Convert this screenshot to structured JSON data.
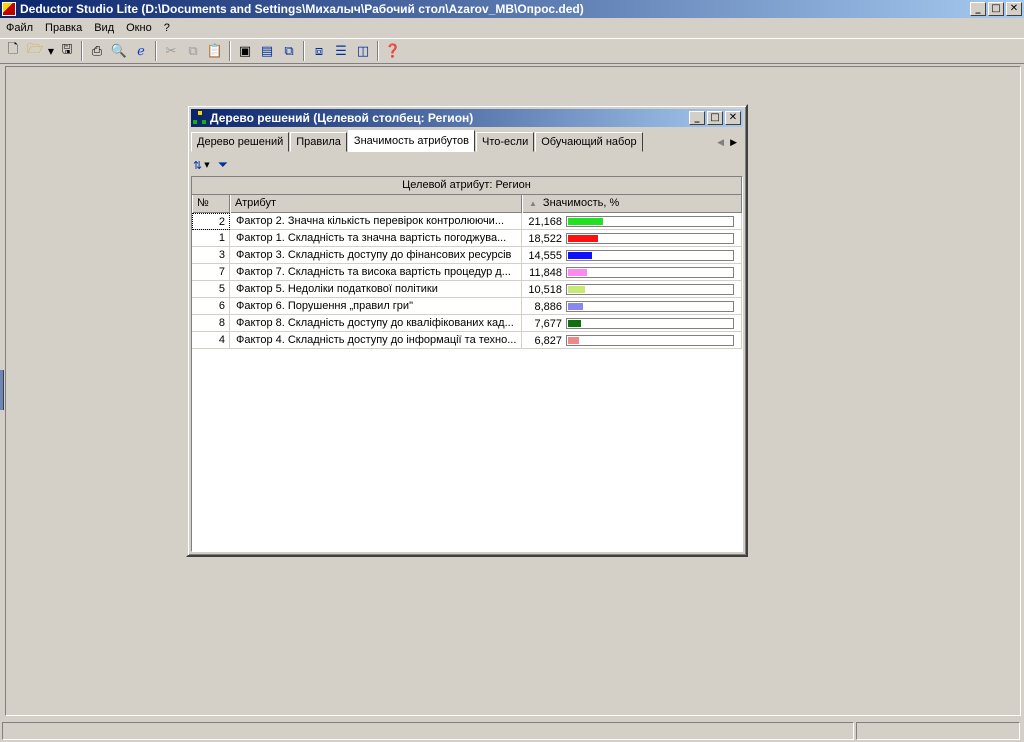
{
  "app": {
    "title": "Deductor Studio Lite (D:\\Documents and Settings\\Михалыч\\Рабочий стол\\Azarov_MB\\Опрос.ded)",
    "window_buttons": {
      "minimize": "_",
      "maximize": "□",
      "close": "✕"
    }
  },
  "menu": [
    "Файл",
    "Правка",
    "Вид",
    "Окно",
    "?"
  ],
  "toolbar_icons": [
    "new-icon",
    "open-icon",
    "save-icon",
    "print-icon",
    "print-preview-icon",
    "ie-icon",
    "cut-icon",
    "copy-icon",
    "paste-icon",
    "wizard-icon",
    "report-icon",
    "windows-icon",
    "cascade-icon",
    "tile-horizontal-icon",
    "tile-vertical-icon",
    "help-icon"
  ],
  "child_window": {
    "title": "Дерево решений (Целевой столбец: Регион)",
    "tabs": [
      "Дерево решений",
      "Правила",
      "Значимость атрибутов",
      "Что-если",
      "Обучающий набор"
    ],
    "active_tab": "Значимость атрибутов",
    "grid": {
      "group_header": "Целевой атрибут: Регион",
      "columns": {
        "num": "№",
        "attr": "Атрибут",
        "sig": "Значимость, %"
      },
      "rows": [
        {
          "num": "2",
          "attr": "Фактор 2. Значна кількість перевірок контролюючи...",
          "sig": "21,168",
          "value": 21.168,
          "color": "#22e022"
        },
        {
          "num": "1",
          "attr": "Фактор 1. Складність та значна вартість погоджува...",
          "sig": "18,522",
          "value": 18.522,
          "color": "#ff1010"
        },
        {
          "num": "3",
          "attr": "Фактор 3. Складність доступу до фінансових ресурсів",
          "sig": "14,555",
          "value": 14.555,
          "color": "#1010ff"
        },
        {
          "num": "7",
          "attr": "Фактор 7. Складність та висока вартість процедур д...",
          "sig": "11,848",
          "value": 11.848,
          "color": "#ff88ee"
        },
        {
          "num": "5",
          "attr": "Фактор 5. Недоліки податкової політики",
          "sig": "10,518",
          "value": 10.518,
          "color": "#c8e878"
        },
        {
          "num": "6",
          "attr": "Фактор 6. Порушення „правил гри\"",
          "sig": "8,886",
          "value": 8.886,
          "color": "#8888ee"
        },
        {
          "num": "8",
          "attr": "Фактор 8. Складність доступу до кваліфікованих кад...",
          "sig": "7,677",
          "value": 7.677,
          "color": "#107010"
        },
        {
          "num": "4",
          "attr": "Фактор 4. Складність доступу до інформації та техно...",
          "sig": "6,827",
          "value": 6.827,
          "color": "#f08888"
        }
      ]
    }
  }
}
